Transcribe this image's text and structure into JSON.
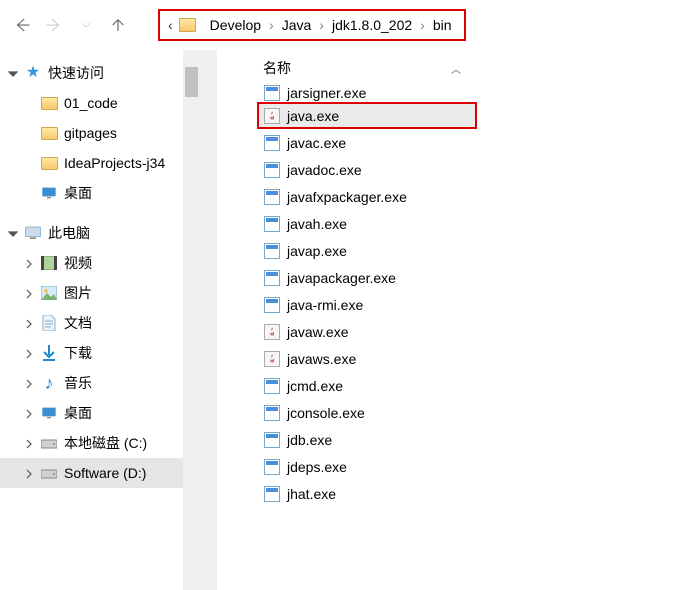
{
  "nav": {
    "prefix": "‹"
  },
  "breadcrumb": [
    "Develop",
    "Java",
    "jdk1.8.0_202",
    "bin"
  ],
  "sidebar": {
    "groups": [
      {
        "label": "快速访问",
        "iconType": "star",
        "expanded": true,
        "children": [
          {
            "label": "01_code",
            "iconType": "folder"
          },
          {
            "label": "gitpages",
            "iconType": "folder"
          },
          {
            "label": "IdeaProjects-j34",
            "iconType": "folder"
          },
          {
            "label": "桌面",
            "iconType": "monitor"
          }
        ]
      },
      {
        "label": "此电脑",
        "iconType": "pc",
        "expanded": true,
        "children": [
          {
            "label": "视频",
            "iconType": "media-video"
          },
          {
            "label": "图片",
            "iconType": "media-photo"
          },
          {
            "label": "文档",
            "iconType": "doc"
          },
          {
            "label": "下载",
            "iconType": "down"
          },
          {
            "label": "音乐",
            "iconType": "music"
          },
          {
            "label": "桌面",
            "iconType": "monitor"
          },
          {
            "label": "本地磁盘 (C:)",
            "iconType": "drive"
          },
          {
            "label": "Software (D:)",
            "iconType": "drive",
            "selected": true
          }
        ]
      }
    ]
  },
  "fileColumn": {
    "header": "名称",
    "files": [
      {
        "name": "jarsigner.exe",
        "iconType": "exe",
        "partialTop": true
      },
      {
        "name": "java.exe",
        "iconType": "java",
        "highlighted": true
      },
      {
        "name": "javac.exe",
        "iconType": "exe"
      },
      {
        "name": "javadoc.exe",
        "iconType": "exe"
      },
      {
        "name": "javafxpackager.exe",
        "iconType": "exe"
      },
      {
        "name": "javah.exe",
        "iconType": "exe"
      },
      {
        "name": "javap.exe",
        "iconType": "exe"
      },
      {
        "name": "javapackager.exe",
        "iconType": "exe"
      },
      {
        "name": "java-rmi.exe",
        "iconType": "exe"
      },
      {
        "name": "javaw.exe",
        "iconType": "java"
      },
      {
        "name": "javaws.exe",
        "iconType": "java"
      },
      {
        "name": "jcmd.exe",
        "iconType": "exe"
      },
      {
        "name": "jconsole.exe",
        "iconType": "exe"
      },
      {
        "name": "jdb.exe",
        "iconType": "exe"
      },
      {
        "name": "jdeps.exe",
        "iconType": "exe"
      },
      {
        "name": "jhat.exe",
        "iconType": "exe"
      }
    ]
  }
}
